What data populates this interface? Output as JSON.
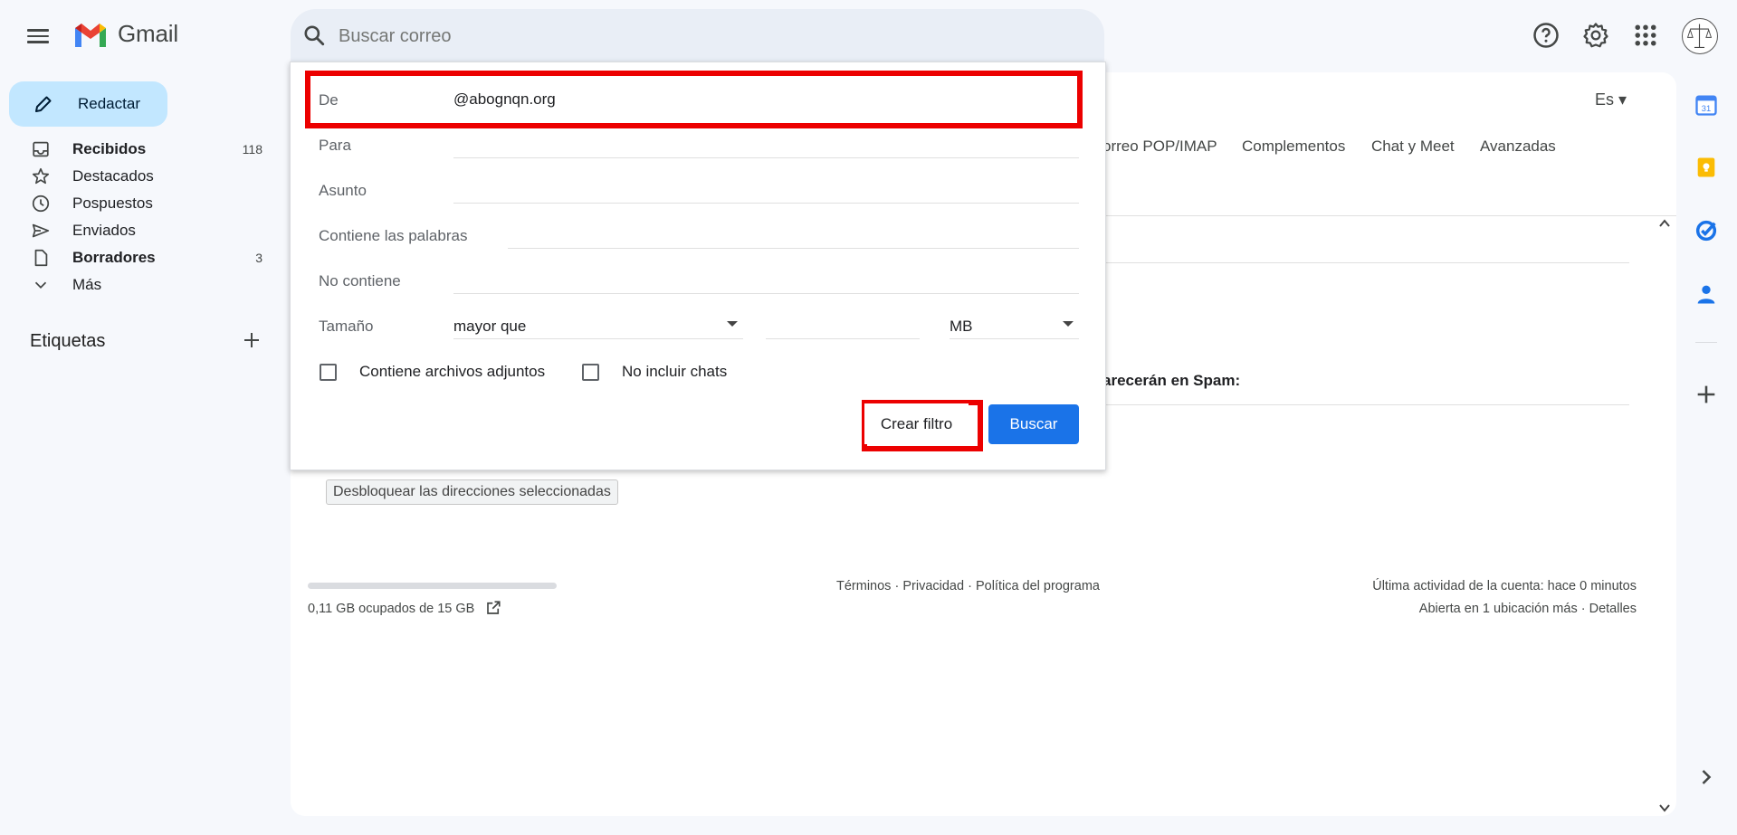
{
  "app": {
    "name": "Gmail"
  },
  "search": {
    "placeholder": "Buscar correo"
  },
  "compose": {
    "label": "Redactar"
  },
  "nav": {
    "items": [
      {
        "label": "Recibidos",
        "count": "118",
        "bold": true
      },
      {
        "label": "Destacados",
        "count": ""
      },
      {
        "label": "Pospuestos",
        "count": ""
      },
      {
        "label": "Enviados",
        "count": ""
      },
      {
        "label": "Borradores",
        "count": "3",
        "bold": true
      },
      {
        "label": "Más",
        "count": ""
      }
    ],
    "labels_header": "Etiquetas"
  },
  "settings": {
    "language": "Es",
    "tabs": [
      "orreo POP/IMAP",
      "Complementos",
      "Chat y Meet",
      "Avanzadas"
    ],
    "spam_text": "arecerán en Spam:",
    "unblock_button": "Desbloquear las direcciones seleccionadas"
  },
  "footer": {
    "storage": "0,11 GB ocupados de 15 GB",
    "terms": "Términos",
    "privacy": "Privacidad",
    "program": "Política del programa",
    "sep": "·",
    "last_activity": "Última actividad de la cuenta: hace 0 minutos",
    "open_in": "Abierta en 1 ubicación más",
    "details": "Detalles"
  },
  "filter": {
    "from_label": "De",
    "from_value": "@abognqn.org",
    "to_label": "Para",
    "subject_label": "Asunto",
    "has_words_label": "Contiene las palabras",
    "no_words_label": "No contiene",
    "size_label": "Tamaño",
    "size_op": "mayor que",
    "size_unit": "MB",
    "has_attachment": "Contiene archivos adjuntos",
    "no_chats": "No incluir chats",
    "create_filter": "Crear filtro",
    "search": "Buscar"
  },
  "colors": {
    "accent": "#1a73e8",
    "highlight": "#ec0000",
    "compose": "#c2e7ff"
  }
}
